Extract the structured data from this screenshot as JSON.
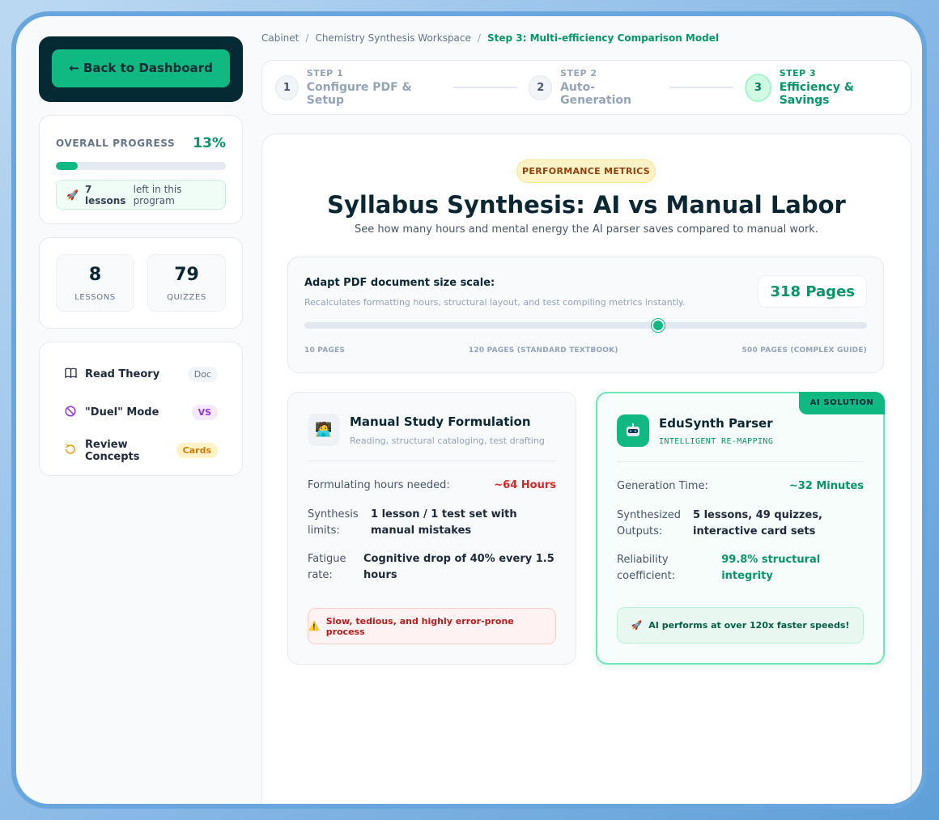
{
  "sidebar": {
    "back_label": "← Back to Dashboard",
    "progress": {
      "label": "OVERALL PROGRESS",
      "percent_text": "13%",
      "percent": 13,
      "lessons_left_count": "7 lessons",
      "lessons_left_text": "left in this program"
    },
    "stats": [
      {
        "value": "8",
        "label": "LESSONS"
      },
      {
        "value": "79",
        "label": "QUIZZES"
      }
    ],
    "menu": [
      {
        "label": "Read Theory",
        "badge": "Doc"
      },
      {
        "label": "\"Duel\" Mode",
        "badge": "VS"
      },
      {
        "label": "Review Concepts",
        "badge": "Cards"
      }
    ]
  },
  "breadcrumb": {
    "items": [
      "Cabinet",
      "Chemistry Synthesis Workspace"
    ],
    "separator": "/",
    "current": "Step 3: Multi-efficiency Comparison Model"
  },
  "steps": [
    {
      "number": "1",
      "kicker": "STEP 1",
      "title": "Configure PDF & Setup"
    },
    {
      "number": "2",
      "kicker": "STEP 2",
      "title": "Auto-Generation"
    },
    {
      "number": "3",
      "kicker": "STEP 3",
      "title": "Efficiency & Savings"
    }
  ],
  "main": {
    "badge": "PERFORMANCE METRICS",
    "title": "Syllabus Synthesis: AI vs Manual Labor",
    "subtitle": "See how many hours and mental energy the AI parser saves compared to manual work."
  },
  "scale": {
    "title": "Adapt PDF document size scale:",
    "description": "Recalculates formatting hours, structural layout, and test compiling metrics instantly.",
    "pages_label": "318 Pages",
    "value": 318,
    "min": 10,
    "max": 500,
    "labels": [
      "10 PAGES",
      "120 PAGES (STANDARD TEXTBOOK)",
      "500 PAGES (COMPLEX GUIDE)"
    ]
  },
  "manual": {
    "title": "Manual Study Formulation",
    "subtitle": "Reading, structural cataloging, test drafting",
    "rows": [
      {
        "label": "Formulating hours needed:",
        "value": "~64 Hours"
      },
      {
        "label": "Synthesis limits:",
        "value": "1 lesson / 1 test set with manual mistakes"
      },
      {
        "label": "Fatigue rate:",
        "value": "Cognitive drop of 40% every 1.5 hours"
      }
    ],
    "note": "Slow, tedious, and highly error-prone process"
  },
  "ai": {
    "tag": "AI SOLUTION",
    "title": "EduSynth Parser",
    "subtitle": "INTELLIGENT RE-MAPPING",
    "rows": [
      {
        "label": "Generation Time:",
        "value": "~32 Minutes"
      },
      {
        "label": "Synthesized Outputs:",
        "value": "5 lessons, 49 quizzes, interactive card sets"
      },
      {
        "label": "Reliability coefficient:",
        "value": "99.8% structural integrity"
      }
    ],
    "note": "AI performs at over 120x faster speeds!"
  },
  "colors": {
    "accent": "#10b981",
    "dark": "#062a33",
    "danger": "#dc2626"
  }
}
